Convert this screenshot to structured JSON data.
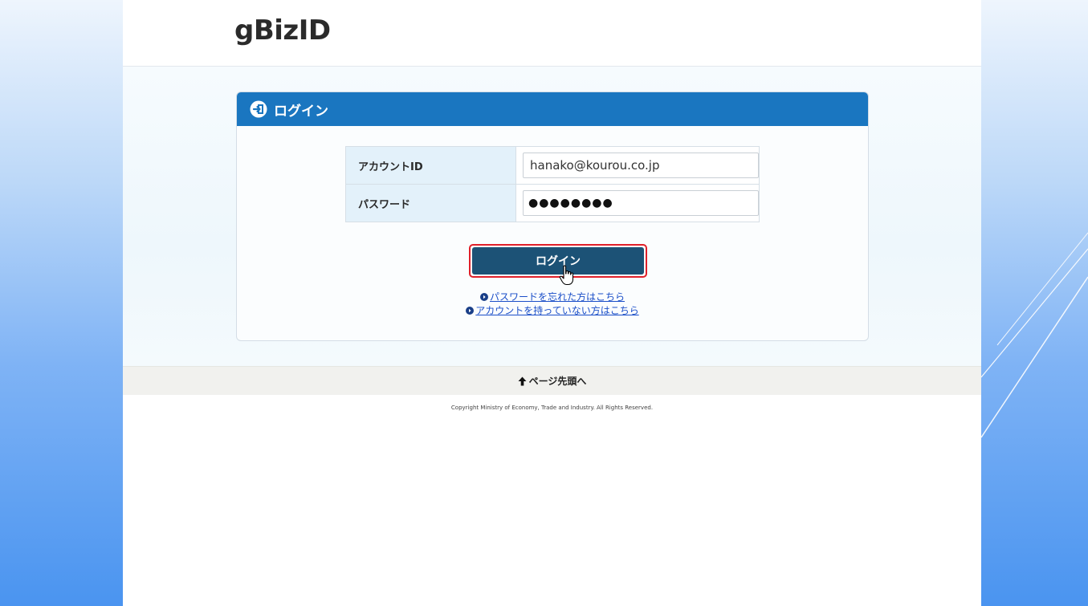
{
  "header": {
    "logo_text": "gBizID"
  },
  "login_card": {
    "title": "ログイン",
    "fields": [
      {
        "label": "アカウントID",
        "value": "hanako@kourou.co.jp"
      },
      {
        "label": "パスワード",
        "masked_value": "●●●●●●●●"
      }
    ],
    "login_button_label": "ログイン",
    "links": [
      {
        "text": "パスワードを忘れた方はこちら"
      },
      {
        "text": "アカウントを持っていない方はこちら"
      }
    ]
  },
  "footer": {
    "page_top_label": "ページ先頭へ",
    "copyright": "Copyright Ministry of Economy, Trade and Industry. All Rights Reserved."
  },
  "colors": {
    "header_blue": "#1a76c0",
    "button_dark": "#1c5276",
    "highlight_red": "#e0202a",
    "link_blue": "#1a4ec8"
  },
  "icons": {
    "card_header": "login-circle-icon",
    "link_bullet": "circle-arrow-icon",
    "page_top": "up-arrow-icon",
    "pointer": "hand-pointer-icon"
  }
}
